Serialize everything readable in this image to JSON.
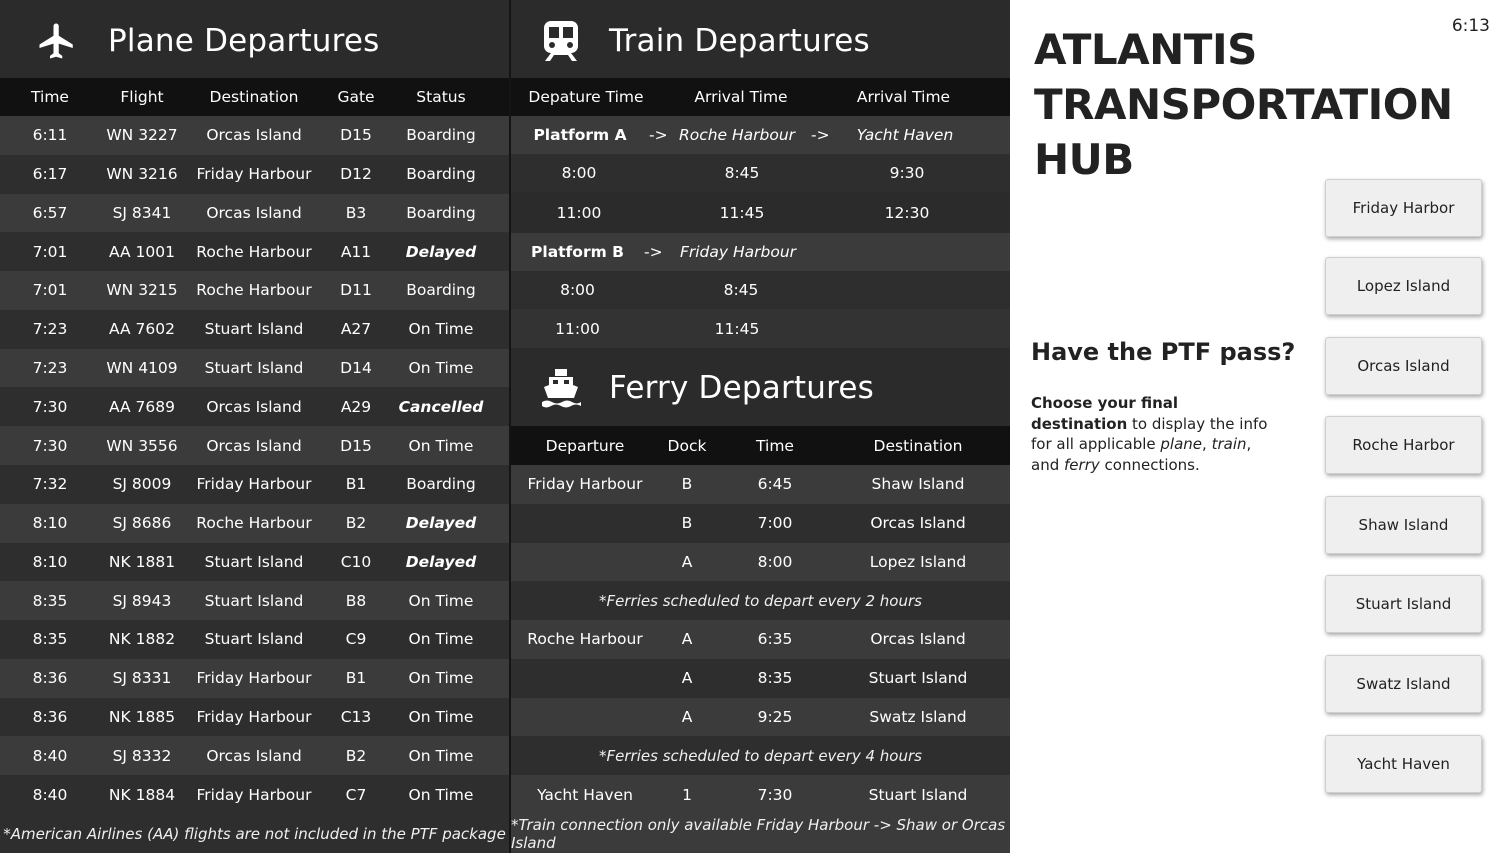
{
  "plane": {
    "title": "Plane Departures",
    "icon": "airplane-icon",
    "headers": [
      "Time",
      "Flight",
      "Destination",
      "Gate",
      "Status"
    ],
    "rows": [
      [
        "6:11",
        "WN 3227",
        "Orcas Island",
        "D15",
        "Boarding"
      ],
      [
        "6:17",
        "WN 3216",
        "Friday Harbour",
        "D12",
        "Boarding"
      ],
      [
        "6:57",
        "SJ 8341",
        "Orcas Island",
        "B3",
        "Boarding"
      ],
      [
        "7:01",
        "AA 1001",
        "Roche Harbour",
        "A11",
        "Delayed"
      ],
      [
        "7:01",
        "WN 3215",
        "Roche Harbour",
        "D11",
        "Boarding"
      ],
      [
        "7:23",
        "AA 7602",
        "Stuart Island",
        "A27",
        "On Time"
      ],
      [
        "7:23",
        "WN 4109",
        "Stuart Island",
        "D14",
        "On Time"
      ],
      [
        "7:30",
        "AA 7689",
        "Orcas Island",
        "A29",
        "Cancelled"
      ],
      [
        "7:30",
        "WN 3556",
        "Orcas Island",
        "D15",
        "On Time"
      ],
      [
        "7:32",
        "SJ 8009",
        "Friday Harbour",
        "B1",
        "Boarding"
      ],
      [
        "8:10",
        "SJ  8686",
        "Roche Harbour",
        "B2",
        "Delayed"
      ],
      [
        "8:10",
        "NK 1881",
        "Stuart Island",
        "C10",
        "Delayed"
      ],
      [
        "8:35",
        "SJ 8943",
        "Stuart Island",
        "B8",
        "On Time"
      ],
      [
        "8:35",
        "NK 1882",
        "Stuart Island",
        "C9",
        "On Time"
      ],
      [
        "8:36",
        "SJ 8331",
        "Friday Harbour",
        "B1",
        "On Time"
      ],
      [
        "8:36",
        "NK 1885",
        "Friday Harbour",
        "C13",
        "On Time"
      ],
      [
        "8:40",
        "SJ 8332",
        "Orcas Island",
        "B2",
        "On Time"
      ],
      [
        "8:40",
        "NK 1884",
        "Friday Harbour",
        "C7",
        "On Time"
      ]
    ],
    "footnote": "*American Airlines (AA) flights are not included in the PTF package"
  },
  "train": {
    "title": "Train Departures",
    "icon": "train-icon",
    "headers": [
      "Depature Time",
      "Arrival Time",
      "Arrival Time"
    ],
    "platform_a": [
      "Platform A",
      "->",
      "Roche Harbour",
      "->",
      "Yacht Haven"
    ],
    "times_a": [
      [
        "8:00",
        "8:45",
        "9:30"
      ],
      [
        "11:00",
        "11:45",
        "12:30"
      ]
    ],
    "platform_b": [
      "Platform B",
      "->",
      "Friday Harbour"
    ],
    "times_b": [
      [
        "8:00",
        "8:45"
      ],
      [
        "11:00",
        "11:45"
      ]
    ]
  },
  "ferry": {
    "title": "Ferry Departures",
    "icon": "ferry-icon",
    "headers": [
      "Departure",
      "Dock",
      "Time",
      "Destination"
    ],
    "rows": [
      [
        "Friday Harbour",
        "B",
        "6:45",
        "Shaw Island"
      ],
      [
        "",
        "B",
        "7:00",
        "Orcas Island"
      ],
      [
        "",
        "A",
        "8:00",
        "Lopez Island"
      ],
      [
        "Roche Harbour",
        "A",
        "6:35",
        "Orcas Island"
      ],
      [
        "",
        "A",
        "8:35",
        "Stuart Island"
      ],
      [
        "",
        "A",
        "9:25",
        "Swatz Island"
      ],
      [
        "Yacht Haven",
        "1",
        "7:30",
        "Stuart Island"
      ]
    ],
    "note1": "*Ferries scheduled to depart every 2 hours",
    "note2": "*Ferries scheduled to depart every 4 hours",
    "footnote": "*Train connection only available Friday Harbour -> Shaw or Orcas Island"
  },
  "hub": {
    "title_line1": "ATLANTIS",
    "title_line2": "TRANSPORTATION",
    "title_line3": "HUB",
    "clock": "6:13",
    "pass_title": "Have the PTF pass?",
    "pass_text_bold": "Choose your final destination",
    "pass_text_1": "to display the info for all applicable",
    "pass_plane": "plane",
    "pass_train": "train",
    "pass_and": ", and",
    "pass_ferry": "ferry",
    "pass_end": "connections."
  },
  "destinations": [
    "Friday Harbor",
    "Lopez Island",
    "Orcas Island",
    "Roche Harbor",
    "Shaw Island",
    "Stuart Island",
    "Swatz Island",
    "Yacht Haven"
  ],
  "colors": {
    "board": "#2b2b2b",
    "header": "#111111",
    "row_light": "#3b3b3b",
    "row_dark": "#2e2e2e",
    "button": "#efefef"
  }
}
